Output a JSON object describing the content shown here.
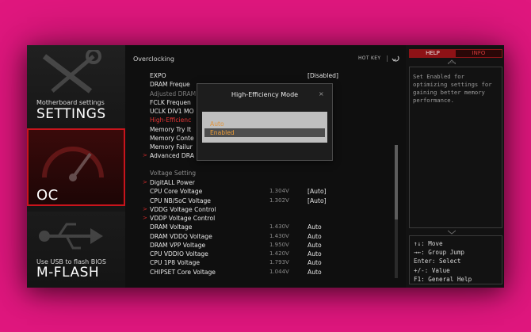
{
  "sidebar": {
    "settings": {
      "subtitle": "Motherboard settings",
      "title": "SETTINGS"
    },
    "oc": {
      "title": "OC"
    },
    "mflash": {
      "subtitle": "Use USB to flash BIOS",
      "title": "M-FLASH"
    }
  },
  "main": {
    "title": "Overclocking",
    "hotkey_label": "HOT KEY",
    "rows_top": [
      {
        "arrow": "",
        "label": "EXPO",
        "num": "",
        "value": "[Disabled]",
        "state": "normal"
      },
      {
        "arrow": "",
        "label": "DRAM Freque",
        "num": "",
        "value": "",
        "state": "normal"
      },
      {
        "arrow": "",
        "label": "Adjusted DRAM",
        "num": "",
        "value": "",
        "state": "dim"
      },
      {
        "arrow": "",
        "label": "FCLK Frequen",
        "num": "",
        "value": "",
        "state": "normal"
      },
      {
        "arrow": "",
        "label": "UCLK DIV1 MO",
        "num": "",
        "value": "",
        "state": "normal"
      },
      {
        "arrow": "",
        "label": "High-Efficienc",
        "num": "",
        "value": "",
        "state": "hl"
      },
      {
        "arrow": "",
        "label": "Memory Try It",
        "num": "",
        "value": "d]",
        "state": "normal"
      },
      {
        "arrow": "",
        "label": "Memory Conte",
        "num": "",
        "value": "",
        "state": "normal"
      },
      {
        "arrow": "",
        "label": "Memory Failur",
        "num": "",
        "value": "",
        "state": "normal"
      },
      {
        "arrow": ">",
        "label": "Advanced DRA",
        "num": "",
        "value": "",
        "state": "normal"
      }
    ],
    "section_voltage": "Voltage Setting",
    "rows_voltage": [
      {
        "arrow": ">",
        "label": "DigitALL Power",
        "num": "",
        "value": "",
        "state": "normal"
      },
      {
        "arrow": "",
        "label": "CPU Core Voltage",
        "num": "1.304V",
        "value": "[Auto]",
        "state": "normal"
      },
      {
        "arrow": "",
        "label": "CPU NB/SoC Voltage",
        "num": "1.302V",
        "value": "[Auto]",
        "state": "normal"
      },
      {
        "arrow": ">",
        "label": "VDDG Voltage Control",
        "num": "",
        "value": "",
        "state": "normal"
      },
      {
        "arrow": ">",
        "label": "VDDP Voltage Control",
        "num": "",
        "value": "",
        "state": "normal"
      },
      {
        "arrow": "",
        "label": "DRAM Voltage",
        "num": "1.430V",
        "value": "Auto",
        "state": "normal"
      },
      {
        "arrow": "",
        "label": "DRAM VDDQ Voltage",
        "num": "1.430V",
        "value": "Auto",
        "state": "normal"
      },
      {
        "arrow": "",
        "label": "DRAM VPP Voltage",
        "num": "1.950V",
        "value": "Auto",
        "state": "normal"
      },
      {
        "arrow": "",
        "label": "CPU VDDIO Voltage",
        "num": "1.420V",
        "value": "Auto",
        "state": "normal"
      },
      {
        "arrow": "",
        "label": "CPU 1P8 Voltage",
        "num": "1.793V",
        "value": "Auto",
        "state": "normal"
      },
      {
        "arrow": "",
        "label": "CHIPSET Core Voltage",
        "num": "1.044V",
        "value": "Auto",
        "state": "normal"
      }
    ]
  },
  "right": {
    "tab_help": "HELP",
    "tab_info": "INFO",
    "help_text": "Set Enabled for optimizing settings for gaining better memory performance.",
    "keys": [
      "↑↓: Move",
      "→←: Group Jump",
      "Enter: Select",
      "+/-: Value",
      "F1: General Help"
    ]
  },
  "dialog": {
    "title": "High-Efficiency Mode",
    "close": "×",
    "options": [
      "Auto",
      "Enabled"
    ],
    "selected": "Enabled"
  },
  "colors": {
    "accent_red": "#c8141c",
    "highlight_red": "#e23434",
    "option_orange": "#f0a03a",
    "background_pink": "#e0177e"
  }
}
